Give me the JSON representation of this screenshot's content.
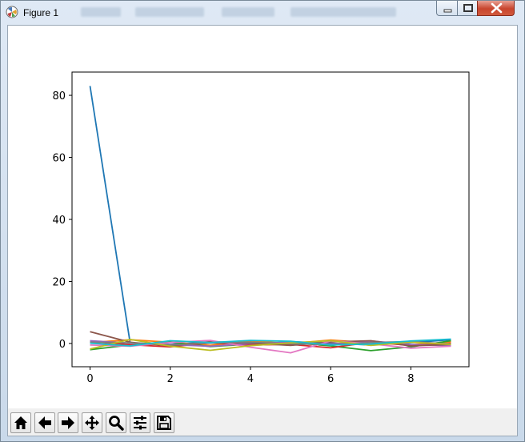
{
  "window": {
    "title": "Figure 1"
  },
  "titlebar": {
    "background_tab_hints": [
      "",
      "",
      "",
      ""
    ]
  },
  "toolbar": {
    "buttons": [
      {
        "name": "home-button",
        "icon": "home-icon"
      },
      {
        "name": "back-button",
        "icon": "arrow-left-icon"
      },
      {
        "name": "forward-button",
        "icon": "arrow-right-icon"
      },
      {
        "name": "pan-button",
        "icon": "move-arrows-icon"
      },
      {
        "name": "zoom-button",
        "icon": "magnifier-icon"
      },
      {
        "name": "configure-subplots-button",
        "icon": "sliders-icon"
      },
      {
        "name": "save-button",
        "icon": "floppy-disk-icon"
      }
    ]
  },
  "chart_data": {
    "type": "line",
    "title": "",
    "xlabel": "",
    "ylabel": "",
    "xlim": [
      -0.45,
      9.45
    ],
    "ylim": [
      -7.5,
      87.5
    ],
    "xticks": [
      0,
      2,
      4,
      6,
      8
    ],
    "yticks": [
      0,
      20,
      40,
      60,
      80
    ],
    "x": [
      0,
      1,
      2,
      3,
      4,
      5,
      6,
      7,
      8,
      9
    ],
    "grid": false,
    "series": [
      {
        "color": "#1f77b4",
        "values": [
          83.0,
          0.2,
          -0.3,
          0.5,
          -0.4,
          0.6,
          0.1,
          -0.5,
          0.3,
          1.2
        ]
      },
      {
        "color": "#ff7f0e",
        "values": [
          0.3,
          1.2,
          0.4,
          -0.6,
          0.8,
          0.0,
          1.1,
          0.2,
          -0.4,
          0.5
        ]
      },
      {
        "color": "#2ca02c",
        "values": [
          -2.0,
          -0.5,
          0.4,
          -1.0,
          -0.2,
          0.3,
          -0.8,
          -2.3,
          -1.1,
          0.9
        ]
      },
      {
        "color": "#d62728",
        "values": [
          0.6,
          -0.4,
          -1.1,
          0.2,
          -0.5,
          -0.3,
          -1.4,
          0.4,
          -0.6,
          0.0
        ]
      },
      {
        "color": "#9467bd",
        "values": [
          0.9,
          0.1,
          -0.4,
          -0.9,
          -0.1,
          0.5,
          -0.2,
          0.8,
          -0.3,
          -0.7
        ]
      },
      {
        "color": "#8c564b",
        "values": [
          3.8,
          0.4,
          -0.8,
          0.6,
          0.1,
          -0.6,
          0.5,
          0.9,
          -0.8,
          -0.3
        ]
      },
      {
        "color": "#e377c2",
        "values": [
          -0.5,
          -0.9,
          0.3,
          1.0,
          -1.2,
          -3.0,
          0.8,
          -0.1,
          -1.5,
          -0.9
        ]
      },
      {
        "color": "#7f7f7f",
        "values": [
          0.4,
          0.2,
          -0.5,
          0.1,
          0.4,
          -0.1,
          -0.4,
          0.3,
          0.6,
          -0.2
        ]
      },
      {
        "color": "#bcbd22",
        "values": [
          -1.8,
          1.3,
          -0.9,
          -2.2,
          -0.7,
          0.2,
          0.9,
          -0.6,
          0.4,
          -0.3
        ]
      },
      {
        "color": "#17becf",
        "values": [
          0.1,
          -0.8,
          0.9,
          0.3,
          1.0,
          0.7,
          -0.5,
          -0.2,
          0.8,
          1.4
        ]
      }
    ]
  }
}
